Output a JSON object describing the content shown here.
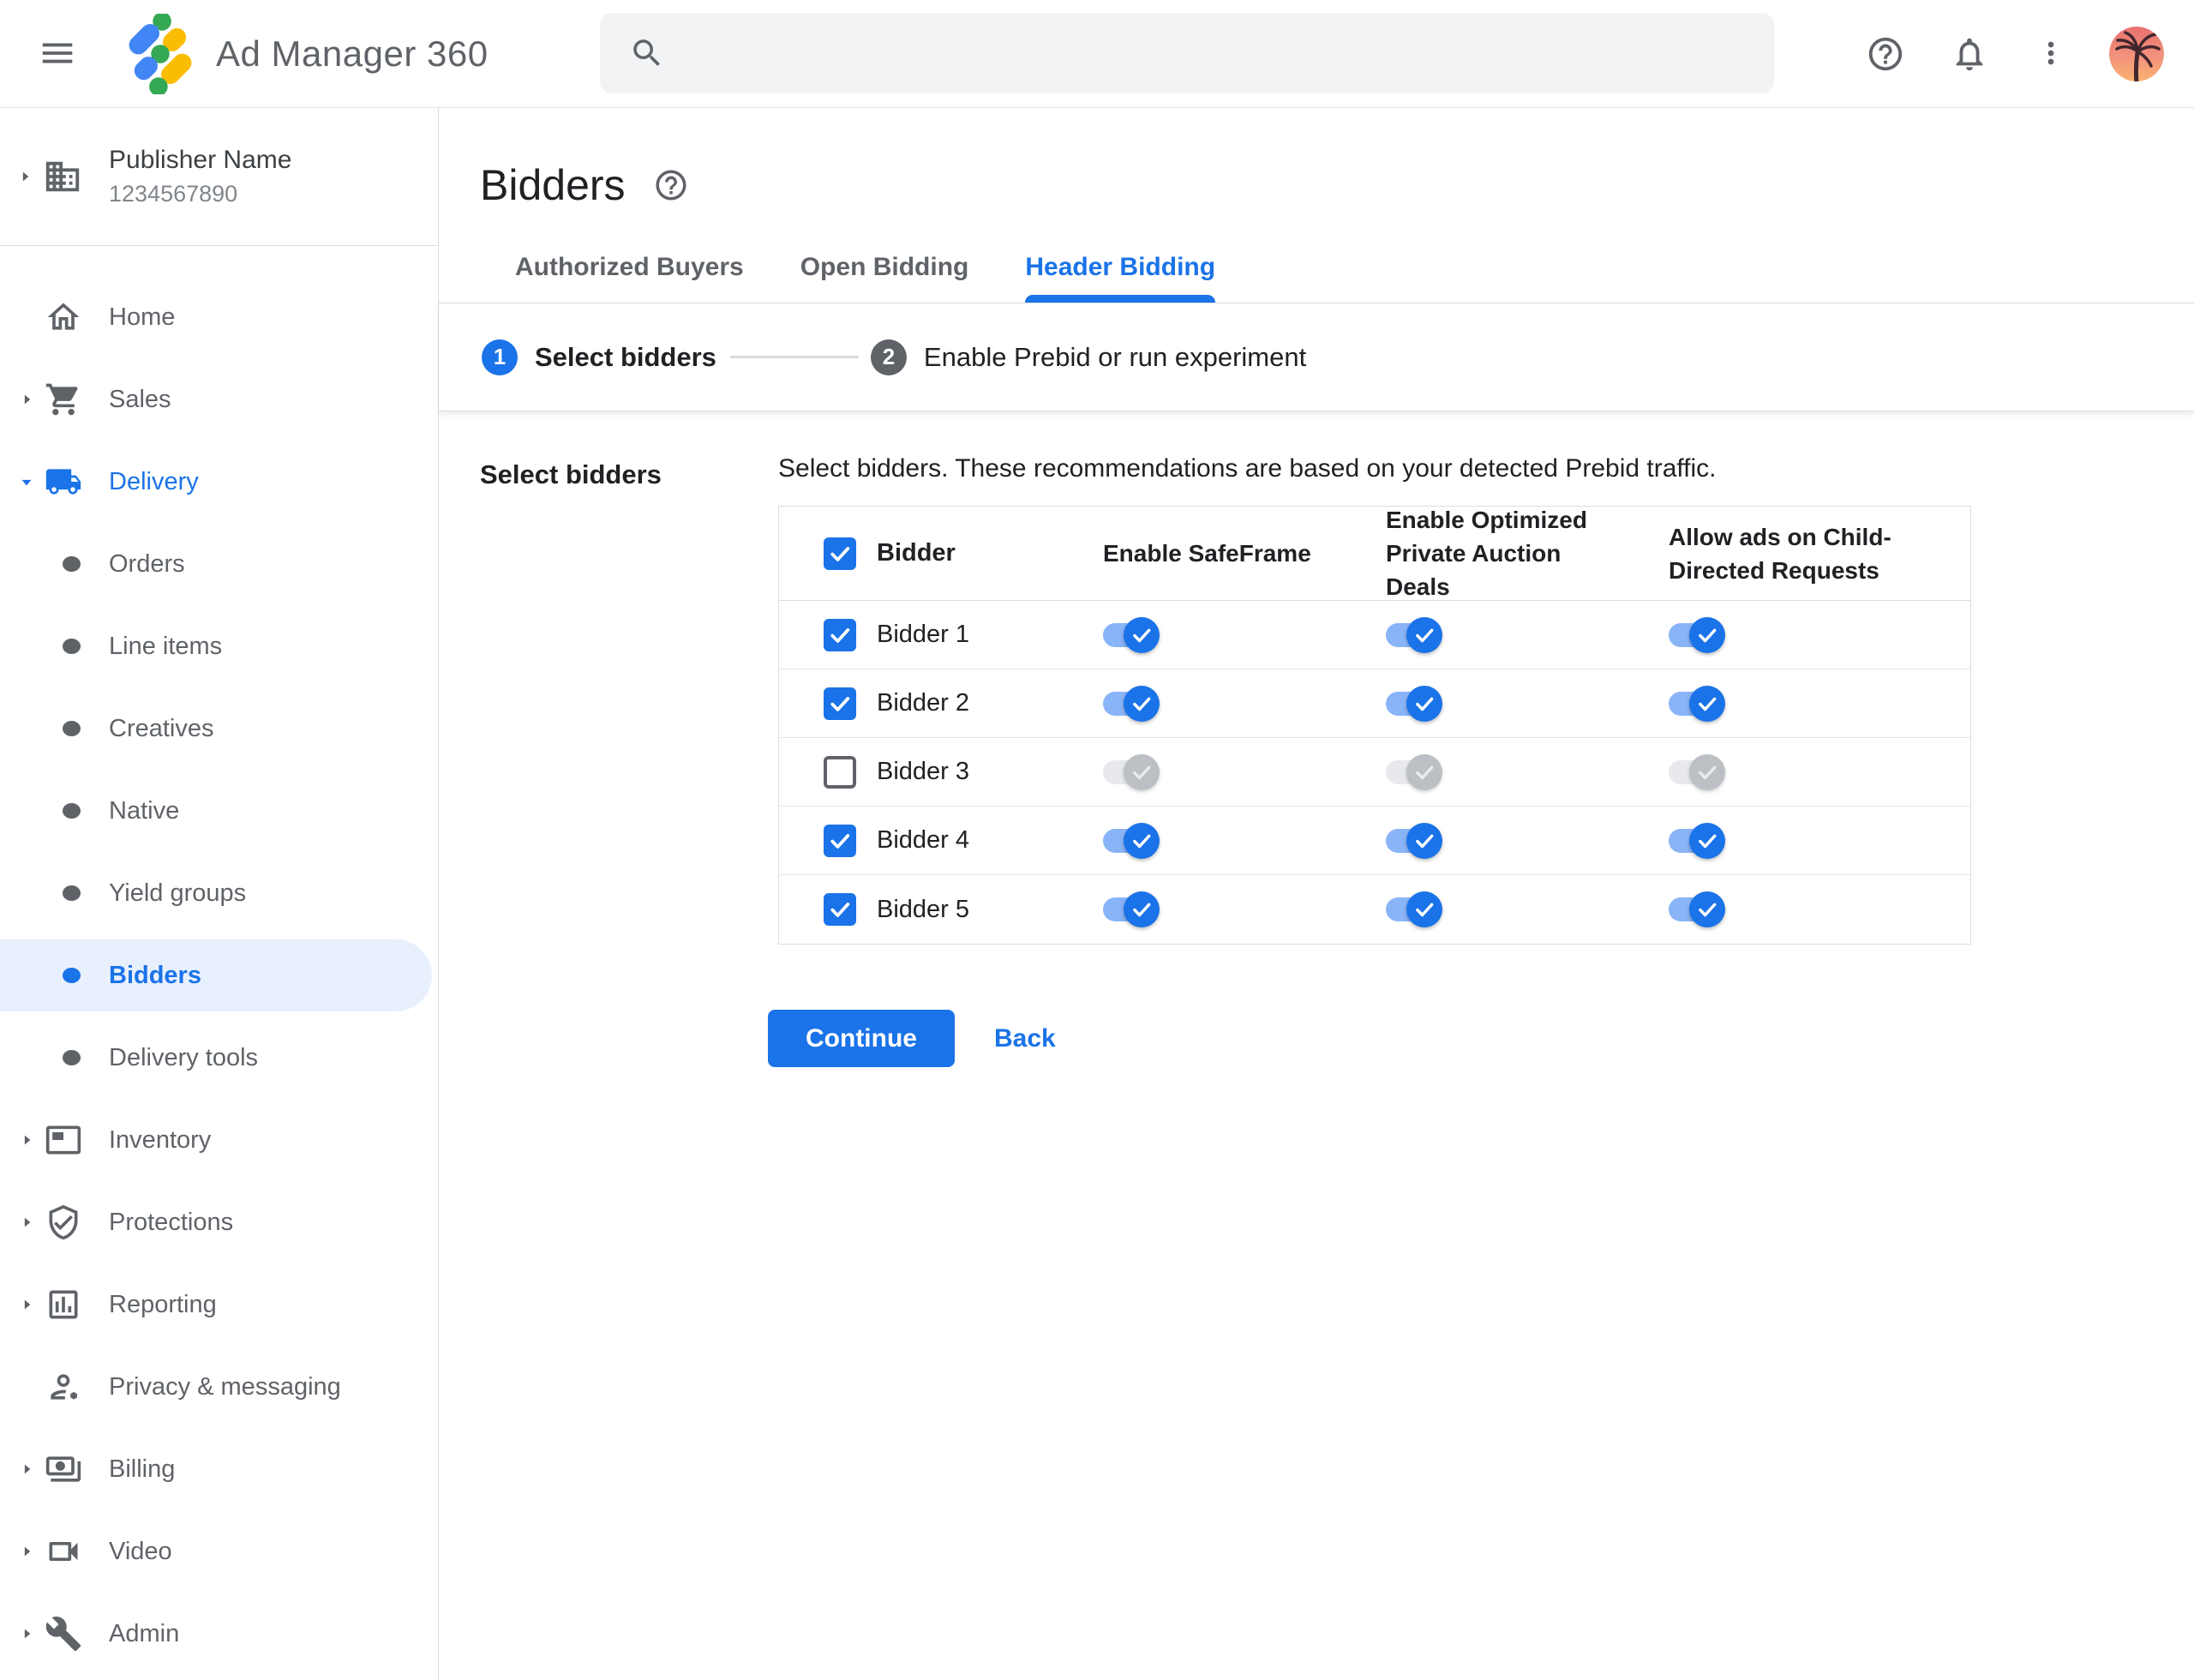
{
  "topbar": {
    "app_name": "Ad Manager 360"
  },
  "sidebar": {
    "publisher": {
      "name": "Publisher Name",
      "id": "1234567890"
    },
    "items": [
      {
        "label": "Home"
      },
      {
        "label": "Sales"
      },
      {
        "label": "Delivery"
      },
      {
        "label": "Inventory"
      },
      {
        "label": "Protections"
      },
      {
        "label": "Reporting"
      },
      {
        "label": "Privacy & messaging"
      },
      {
        "label": "Billing"
      },
      {
        "label": "Video"
      },
      {
        "label": "Admin"
      }
    ],
    "delivery_children": [
      {
        "label": "Orders"
      },
      {
        "label": "Line items"
      },
      {
        "label": "Creatives"
      },
      {
        "label": "Native"
      },
      {
        "label": "Yield groups"
      },
      {
        "label": "Bidders",
        "selected": true
      },
      {
        "label": "Delivery tools"
      }
    ]
  },
  "main": {
    "title": "Bidders",
    "tabs": [
      {
        "label": "Authorized Buyers",
        "active": false
      },
      {
        "label": "Open Bidding",
        "active": false
      },
      {
        "label": "Header Bidding",
        "active": true
      }
    ],
    "steps": [
      {
        "number": "1",
        "label": "Select bidders",
        "state": "active"
      },
      {
        "number": "2",
        "label": "Enable Prebid or run experiment",
        "state": "upcoming"
      }
    ],
    "section_label": "Select bidders",
    "description": "Select bidders. These recommendations are based on your detected Prebid traffic.",
    "table": {
      "columns": [
        "Bidder",
        "Enable SafeFrame",
        "Enable Optimized Private Auction Deals",
        "Allow ads on Child-Directed Requests"
      ],
      "header_checkbox_checked": true,
      "rows": [
        {
          "name": "Bidder 1",
          "checked": true,
          "safeframe": true,
          "optimized_deals": true,
          "child_directed": true
        },
        {
          "name": "Bidder 2",
          "checked": true,
          "safeframe": true,
          "optimized_deals": true,
          "child_directed": true
        },
        {
          "name": "Bidder 3",
          "checked": false,
          "safeframe": false,
          "optimized_deals": false,
          "child_directed": false
        },
        {
          "name": "Bidder 4",
          "checked": true,
          "safeframe": true,
          "optimized_deals": true,
          "child_directed": true
        },
        {
          "name": "Bidder 5",
          "checked": true,
          "safeframe": true,
          "optimized_deals": true,
          "child_directed": true
        }
      ]
    },
    "continue_label": "Continue",
    "back_label": "Back"
  },
  "colors": {
    "accent": "#1a73e8",
    "toggle_track_on": "#8ab4f8",
    "toggle_thumb_off": "#bcc0c4",
    "selected_pill_bg": "#e8f0fe",
    "logo_blue": "#4285f4",
    "logo_yellow": "#fbbc04",
    "logo_green": "#34a853"
  }
}
